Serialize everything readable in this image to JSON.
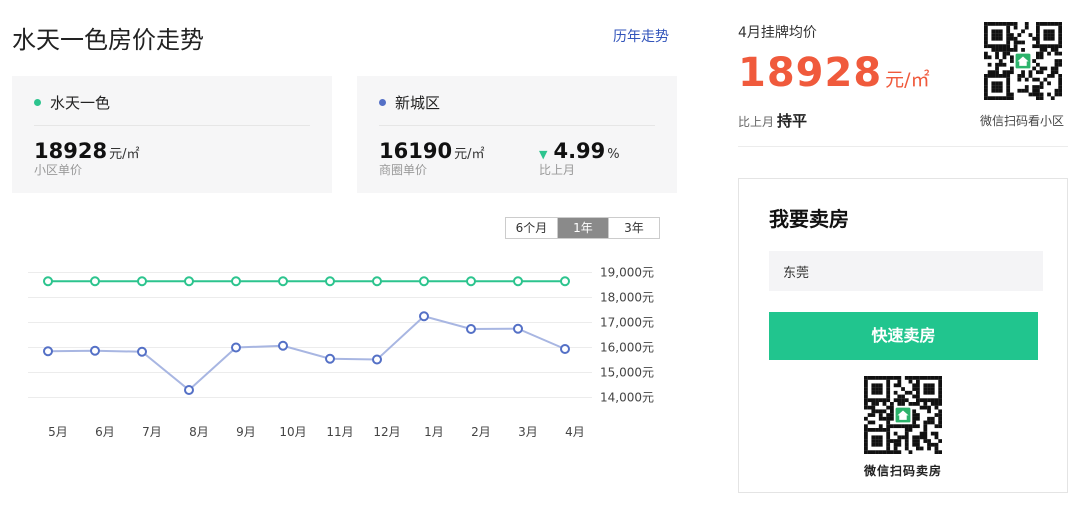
{
  "header": {
    "title": "水天一色房价走势",
    "history_link": "历年走势"
  },
  "cards": [
    {
      "name": "水天一色",
      "dot_color": "#2cc48e",
      "price": "18928",
      "unit": "元/㎡",
      "price_caption": "小区单价"
    },
    {
      "name": "新城区",
      "dot_color": "#5470c6",
      "price": "16190",
      "unit": "元/㎡",
      "price_caption": "商圈单价",
      "change": "4.99",
      "change_unit": "%",
      "change_caption": "比上月",
      "change_direction": "down"
    }
  ],
  "period_tabs": [
    "6个月",
    "1年",
    "3年"
  ],
  "period_selected": "1年",
  "chart_data": {
    "type": "line",
    "categories": [
      "5月",
      "6月",
      "7月",
      "8月",
      "9月",
      "10月",
      "11月",
      "12月",
      "1月",
      "2月",
      "3月",
      "4月"
    ],
    "y_ticks": [
      "19,000元",
      "18,000元",
      "17,000元",
      "16,000元",
      "15,000元",
      "14,000元"
    ],
    "ylim": [
      13500,
      19500
    ],
    "grid": true,
    "series": [
      {
        "name": "水天一色",
        "color": "#2cc48e",
        "values": [
          18650,
          18650,
          18650,
          18650,
          18650,
          18650,
          18650,
          18650,
          18650,
          18650,
          18650,
          18650
        ]
      },
      {
        "name": "新城区",
        "color": "#5470c6",
        "values": [
          15850,
          15870,
          15830,
          14300,
          16000,
          16070,
          15550,
          15520,
          17250,
          16740,
          16750,
          15940
        ]
      }
    ]
  },
  "right": {
    "label": "4月挂牌均价",
    "price": "18928",
    "unit": "元/㎡",
    "compare_label": "比上月",
    "compare_value": "持平",
    "qr_caption": "微信扫码看小区"
  },
  "sell": {
    "title": "我要卖房",
    "city": "东莞",
    "button": "快速卖房",
    "qr_caption": "微信扫码卖房"
  }
}
